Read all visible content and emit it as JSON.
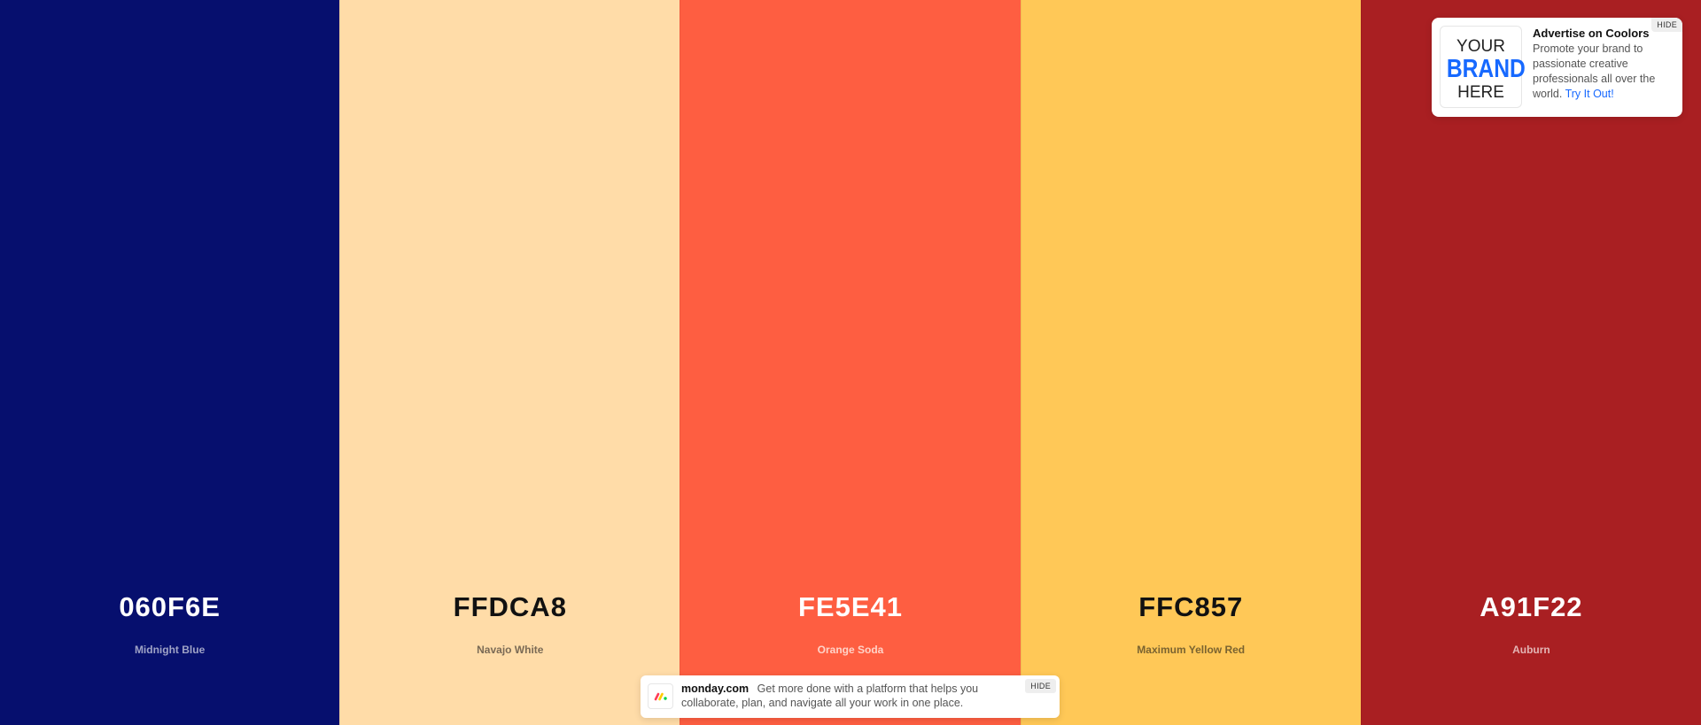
{
  "palette": {
    "swatches": [
      {
        "hex": "060F6E",
        "name": "Midnight Blue",
        "bg": "#060F6E",
        "hex_color": "#FFFFFF",
        "name_color": "#9FA3C6"
      },
      {
        "hex": "FFDCA8",
        "name": "Navajo White",
        "bg": "#FFDCA8",
        "hex_color": "#111111",
        "name_color": "#7A6A55"
      },
      {
        "hex": "FE5E41",
        "name": "Orange Soda",
        "bg": "#FE5E41",
        "hex_color": "#FFFFFF",
        "name_color": "#FFD3C8"
      },
      {
        "hex": "FFC857",
        "name": "Maximum Yellow Red",
        "bg": "#FFC857",
        "hex_color": "#111111",
        "name_color": "#7A6330"
      },
      {
        "hex": "A91F22",
        "name": "Auburn",
        "bg": "#A91F22",
        "hex_color": "#FFFFFF",
        "name_color": "#E3B5B5"
      }
    ]
  },
  "ad": {
    "logo_line1": "YOUR",
    "logo_line2": "BRAND",
    "logo_line3": "HERE",
    "title": "Advertise on Coolors",
    "body": "Promote your brand to passionate creative professionals all over the world.",
    "link": "Try It Out!",
    "hide_label": "HIDE"
  },
  "banner": {
    "brand": "monday.com",
    "text": "Get more done with a platform that helps you collaborate, plan, and navigate all your work in one place.",
    "hide_label": "HIDE",
    "logo_icon": "monday-logo-icon"
  }
}
